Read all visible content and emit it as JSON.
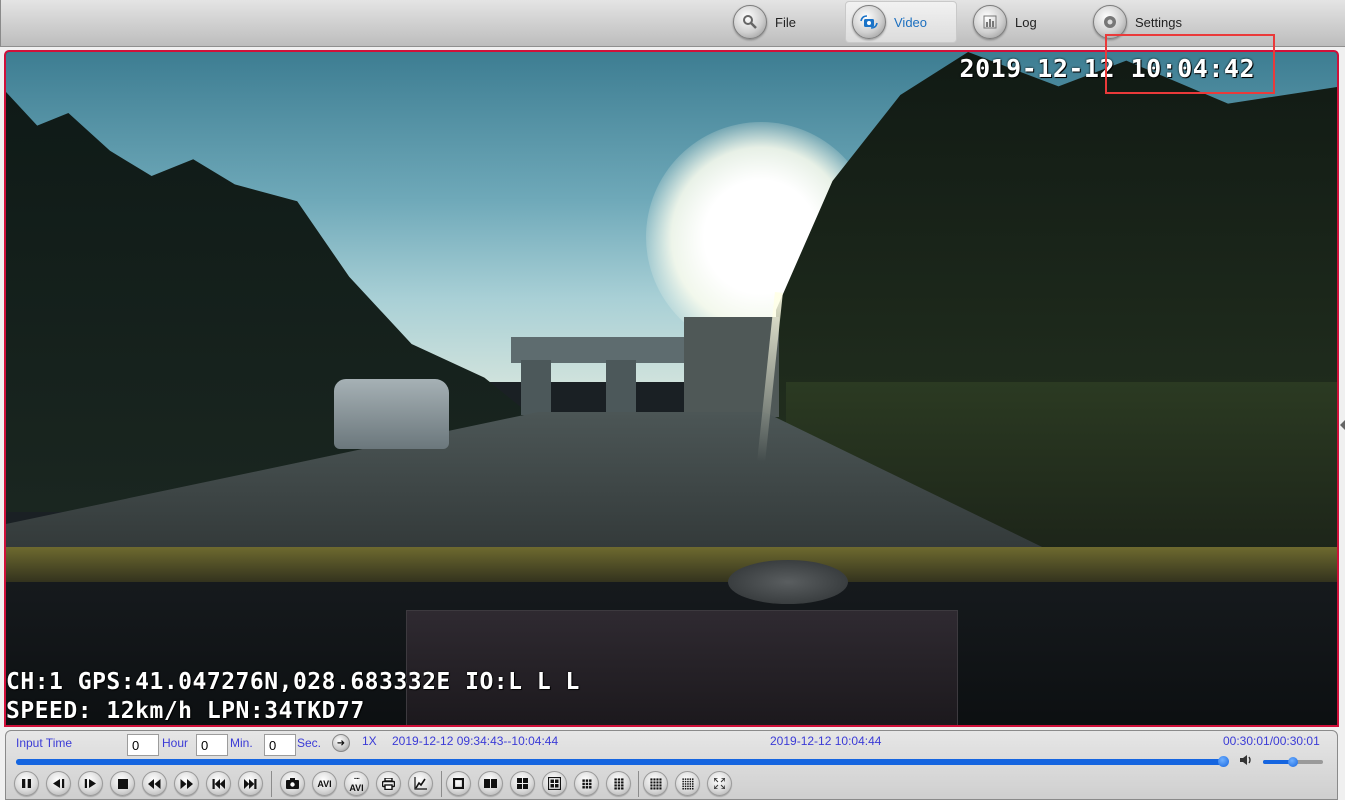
{
  "nav": {
    "tabs": [
      {
        "label": "File",
        "icon": "magnifier-icon",
        "active": false
      },
      {
        "label": "Video",
        "icon": "camera-rotate-icon",
        "active": true
      },
      {
        "label": "Log",
        "icon": "bar-chart-icon",
        "active": false
      },
      {
        "label": "Settings",
        "icon": "gear-icon",
        "active": false
      }
    ]
  },
  "video": {
    "osd_datetime": "2019-12-12 10:04:42",
    "osd_line1": "CH:1 GPS:41.047276N,028.683332E IO:L L L",
    "osd_line2": "SPEED: 12km/h LPN:34TKD77",
    "highlight_color": "#ea3a3a",
    "frame_border_color": "#d0103a"
  },
  "controls": {
    "input_time_label": "Input Time",
    "hour_value": "0",
    "hour_label": "Hour",
    "min_value": "0",
    "min_label": "Min.",
    "sec_value": "0",
    "sec_label": "Sec.",
    "go_symbol": "➜",
    "speed": "1X",
    "range": "2019-12-12 09:34:43--10:04:44",
    "current_timestamp": "2019-12-12 10:04:44",
    "elapsed_total": "00:30:01/00:30:01",
    "progress_fraction": 1.0,
    "volume_fraction": 0.5,
    "text_color": "#3b3bd6",
    "accent_color": "#1565e0",
    "buttons": [
      {
        "name": "pause-button",
        "icon": "pause-icon"
      },
      {
        "name": "step-back-button",
        "icon": "step-back-icon"
      },
      {
        "name": "step-forward-button",
        "icon": "step-forward-icon"
      },
      {
        "name": "stop-button",
        "icon": "stop-icon"
      },
      {
        "name": "rewind-button",
        "icon": "rewind-icon"
      },
      {
        "name": "fast-forward-button",
        "icon": "fast-forward-icon"
      },
      {
        "name": "previous-button",
        "icon": "skip-previous-icon"
      },
      {
        "name": "next-button",
        "icon": "skip-next-icon"
      },
      {
        "name": "snapshot-button",
        "icon": "camera-icon"
      },
      {
        "name": "avi-export-button",
        "icon": "avi-icon",
        "text": "AVI"
      },
      {
        "name": "avi-batch-export-button",
        "icon": "avi-batch-icon",
        "text": "AVI"
      },
      {
        "name": "print-button",
        "icon": "printer-icon"
      },
      {
        "name": "chart-button",
        "icon": "line-chart-icon"
      },
      {
        "name": "layout-1-button",
        "icon": "layout-1-icon"
      },
      {
        "name": "layout-2-button",
        "icon": "layout-2-icon"
      },
      {
        "name": "layout-4-button",
        "icon": "layout-4-icon"
      },
      {
        "name": "layout-4b-button",
        "icon": "layout-4-framed-icon"
      },
      {
        "name": "layout-9-button",
        "icon": "layout-9-icon"
      },
      {
        "name": "layout-12-button",
        "icon": "layout-12-icon"
      },
      {
        "name": "layout-16-button",
        "icon": "layout-16-icon"
      },
      {
        "name": "layout-25-button",
        "icon": "layout-25-icon"
      },
      {
        "name": "fullscreen-button",
        "icon": "fullscreen-icon"
      }
    ]
  }
}
